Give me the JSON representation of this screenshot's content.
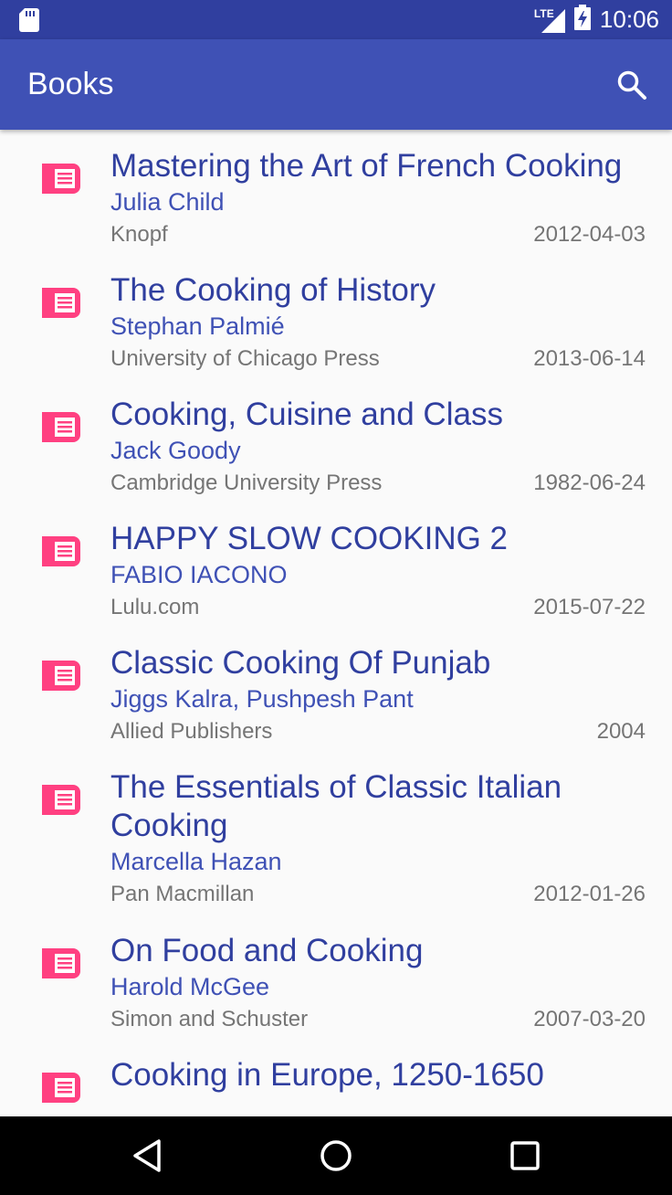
{
  "status_bar": {
    "time": "10:06",
    "network_label": "LTE"
  },
  "app_bar": {
    "title": "Books"
  },
  "books": [
    {
      "title": "Mastering the Art of French Cooking",
      "author": "Julia Child",
      "publisher": "Knopf",
      "date": "2012-04-03"
    },
    {
      "title": "The Cooking of History",
      "author": "Stephan Palmié",
      "publisher": "University of Chicago Press",
      "date": "2013-06-14"
    },
    {
      "title": "Cooking, Cuisine and Class",
      "author": "Jack Goody",
      "publisher": "Cambridge University Press",
      "date": "1982-06-24"
    },
    {
      "title": "HAPPY SLOW COOKING 2",
      "author": "FABIO IACONO",
      "publisher": "Lulu.com",
      "date": "2015-07-22"
    },
    {
      "title": "Classic Cooking Of Punjab",
      "author": "Jiggs Kalra, Pushpesh Pant",
      "publisher": "Allied Publishers",
      "date": "2004"
    },
    {
      "title": "The Essentials of Classic Italian Cooking",
      "author": "Marcella Hazan",
      "publisher": "Pan Macmillan",
      "date": "2012-01-26"
    },
    {
      "title": "On Food and Cooking",
      "author": "Harold McGee",
      "publisher": "Simon and Schuster",
      "date": "2007-03-20"
    },
    {
      "title": "Cooking in Europe, 1250-1650",
      "author": "",
      "publisher": "",
      "date": ""
    }
  ],
  "colors": {
    "primary": "#3F51B5",
    "primary_dark": "#303F9F",
    "book_icon": "#FF4081"
  },
  "icons": [
    "sd-card-icon",
    "signal-icon",
    "battery-charging-icon",
    "search-icon",
    "book-icon",
    "back-icon",
    "home-icon",
    "recents-icon"
  ]
}
